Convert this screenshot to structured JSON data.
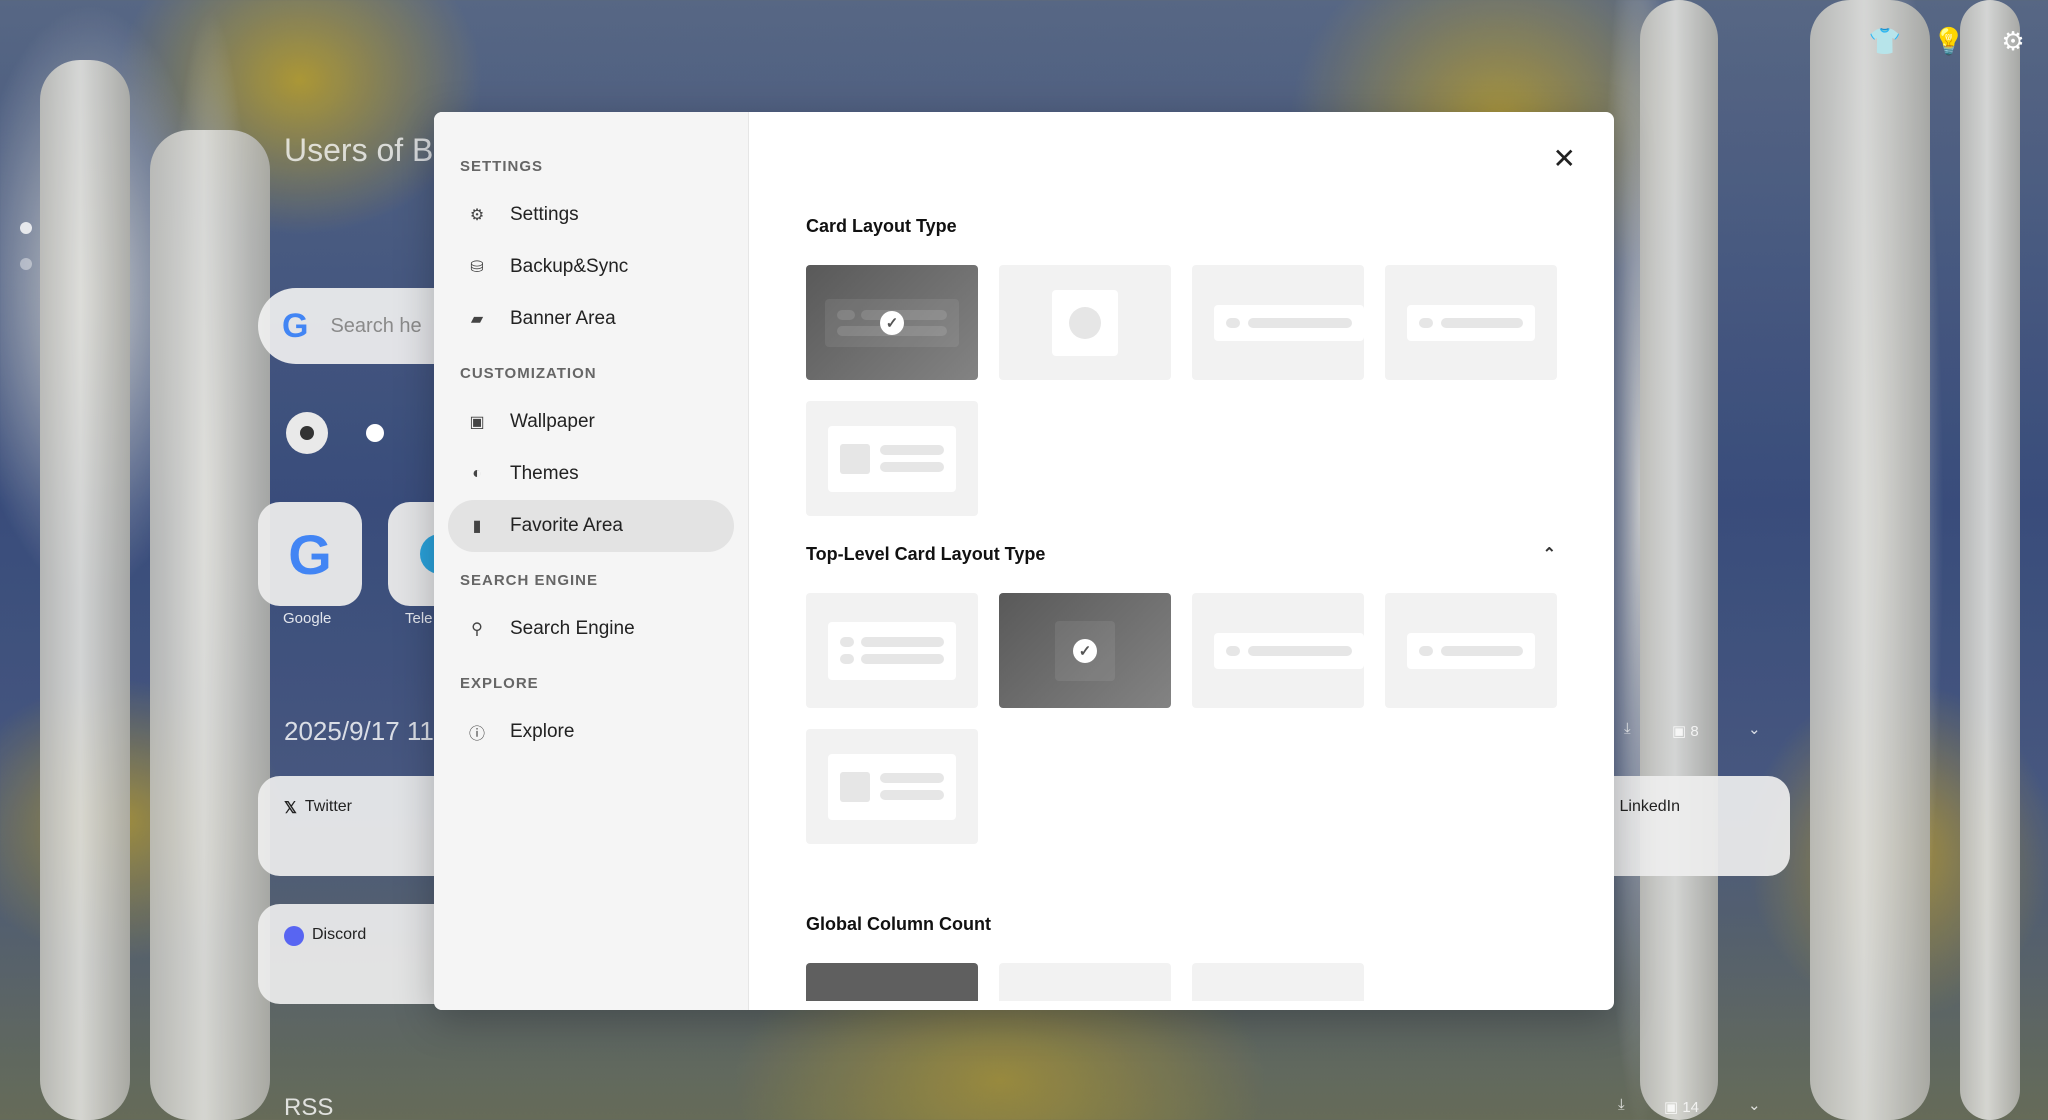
{
  "background": {
    "title": "Users of Bo",
    "search_placeholder": "Search he",
    "google_letter": "G",
    "tiles": [
      {
        "label": "Google",
        "letter": "G"
      },
      {
        "label": "Tele",
        "letter": ""
      }
    ],
    "date": "2025/9/17 11",
    "cards": [
      {
        "label": "Twitter",
        "icon": "x-logo-icon"
      },
      {
        "label": "Discord",
        "icon": "discord-icon"
      },
      {
        "label": "LinkedIn",
        "icon": "linkedin-icon"
      }
    ],
    "rss": "RSS",
    "count_a": "8",
    "count_b": "14"
  },
  "sidebar": {
    "sections": [
      {
        "title": "SETTINGS",
        "items": [
          {
            "label": "Settings",
            "icon": "gear-icon"
          },
          {
            "label": "Backup&Sync",
            "icon": "sync-icon"
          },
          {
            "label": "Banner Area",
            "icon": "banner-icon"
          }
        ]
      },
      {
        "title": "CUSTOMIZATION",
        "items": [
          {
            "label": "Wallpaper",
            "icon": "image-icon"
          },
          {
            "label": "Themes",
            "icon": "palette-icon"
          },
          {
            "label": "Favorite Area",
            "icon": "bookmark-icon",
            "active": true
          }
        ]
      },
      {
        "title": "SEARCH ENGINE",
        "items": [
          {
            "label": "Search Engine",
            "icon": "search-icon"
          }
        ]
      },
      {
        "title": "EXPLORE",
        "items": [
          {
            "label": "Explore",
            "icon": "info-icon"
          }
        ]
      }
    ]
  },
  "content": {
    "card_layout_title": "Card Layout Type",
    "top_level_title": "Top-Level Card Layout Type",
    "global_column_title": "Global Column Count"
  }
}
